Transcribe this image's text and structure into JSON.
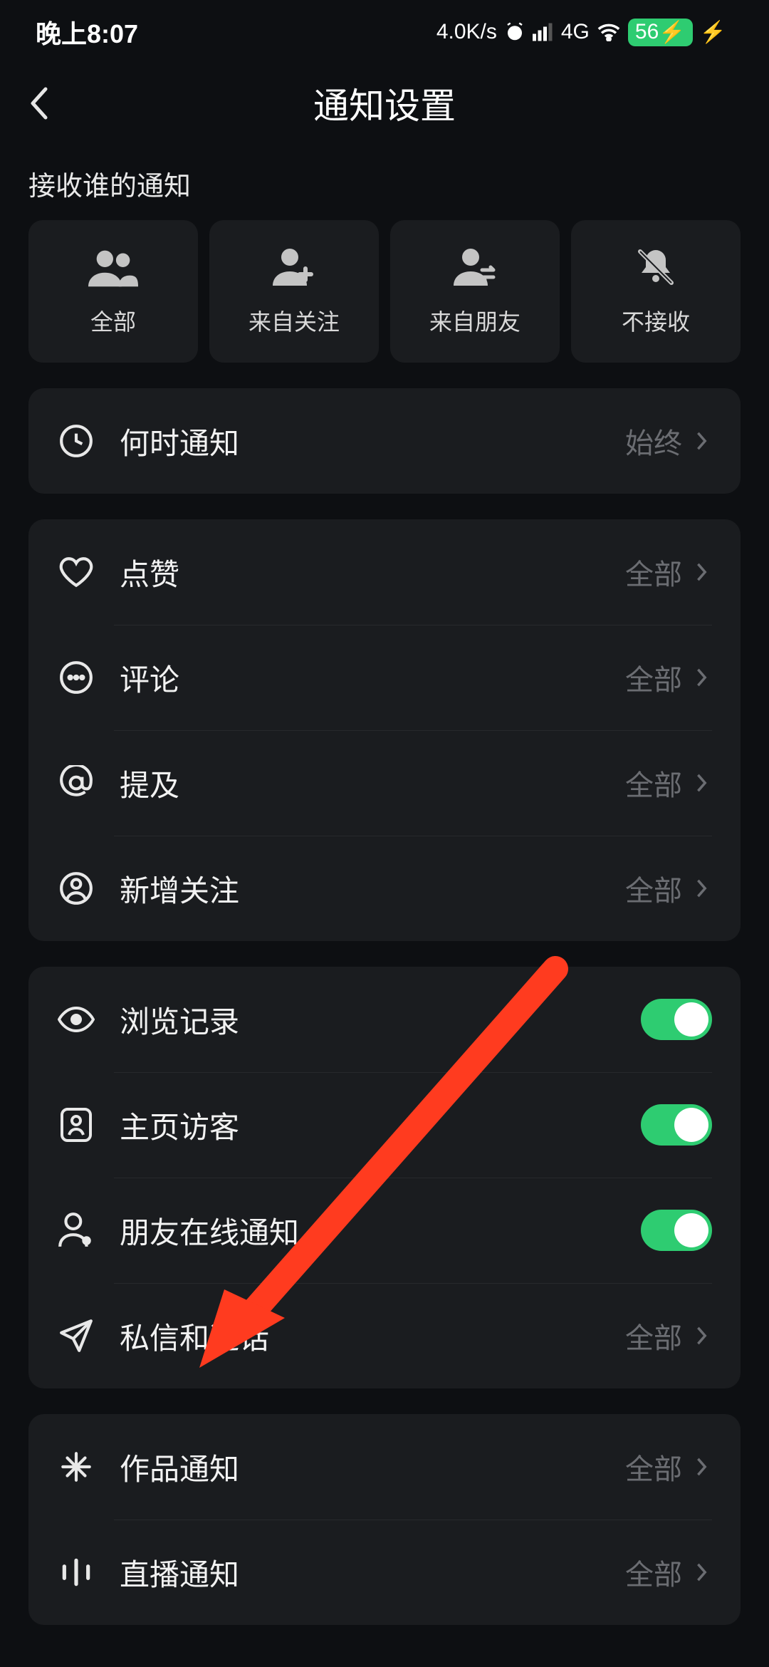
{
  "status": {
    "time": "晚上8:07",
    "speed": "4.0K/s",
    "signal_label": "4G",
    "battery": "56"
  },
  "header": {
    "title": "通知设置"
  },
  "section_label": "接收谁的通知",
  "filters": [
    {
      "label": "全部",
      "icon": "people-icon"
    },
    {
      "label": "来自关注",
      "icon": "person-plus-icon"
    },
    {
      "label": "来自朋友",
      "icon": "person-exchange-icon"
    },
    {
      "label": "不接收",
      "icon": "bell-off-icon"
    }
  ],
  "group_when": {
    "when_notify": {
      "title": "何时通知",
      "value": "始终"
    }
  },
  "group_interact": {
    "like": {
      "title": "点赞",
      "value": "全部"
    },
    "comment": {
      "title": "评论",
      "value": "全部"
    },
    "mention": {
      "title": "提及",
      "value": "全部"
    },
    "follower": {
      "title": "新增关注",
      "value": "全部"
    }
  },
  "group_activity": {
    "history": {
      "title": "浏览记录",
      "toggle": true
    },
    "visitor": {
      "title": "主页访客",
      "toggle": true
    },
    "online": {
      "title": "朋友在线通知",
      "toggle": true
    },
    "message": {
      "title": "私信和通话",
      "value": "全部"
    }
  },
  "group_content": {
    "works": {
      "title": "作品通知",
      "value": "全部"
    },
    "live": {
      "title": "直播通知",
      "value": "全部"
    }
  }
}
